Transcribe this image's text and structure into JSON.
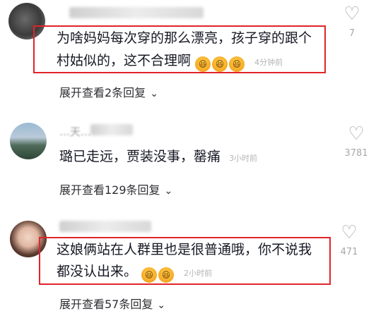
{
  "comments": [
    {
      "author": "",
      "text_line1": "为啥妈妈每次穿的那么漂亮，孩子穿的跟个",
      "text_line2": "村姑似的，这不合理啊",
      "emojis": [
        "laughing-emoji",
        "laughing-emoji",
        "laughing-emoji"
      ],
      "time": "4分钟前",
      "reply_label": "展开查看2条回复",
      "like_count": "7"
    },
    {
      "author": "…天…",
      "text_line1": "璐已走远，贾装没事，Ⅲ痛",
      "text_display": "璐已走远，贾装没事，罄痛",
      "emojis": [],
      "time": "3小时前",
      "reply_label": "展开查看129条回复",
      "like_count": "3781"
    },
    {
      "author": "",
      "text_line1": "这娘俩站在人群里也是很普通哦，你不说我",
      "text_line2": "都没认出来。",
      "emojis": [
        "laughing-emoji",
        "laughing-emoji"
      ],
      "time": "2小时前",
      "reply_label": "展开查看57条回复",
      "like_count": "471"
    }
  ],
  "colors": {
    "highlight_box": "#e0242a",
    "text": "#161823",
    "muted": "#a8a8a8"
  }
}
